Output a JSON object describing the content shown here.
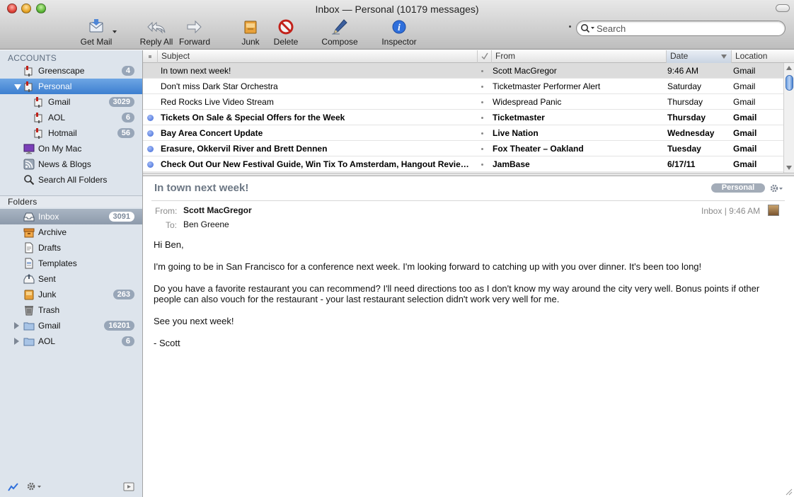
{
  "window": {
    "title": "Inbox — Personal (10179 messages)"
  },
  "toolbar": {
    "get_mail": "Get Mail",
    "reply_all": "Reply All",
    "forward": "Forward",
    "junk": "Junk",
    "delete": "Delete",
    "compose": "Compose",
    "inspector": "Inspector",
    "search_placeholder": "Search"
  },
  "sidebar": {
    "accounts_header": "ACCOUNTS",
    "folders_header": "Folders",
    "accounts": [
      {
        "label": "Greenscape",
        "badge": "4"
      },
      {
        "label": "Personal",
        "badge": ""
      },
      {
        "label": "Gmail",
        "badge": "3029"
      },
      {
        "label": "AOL",
        "badge": "6"
      },
      {
        "label": "Hotmail",
        "badge": "56"
      },
      {
        "label": "On My Mac",
        "badge": ""
      },
      {
        "label": "News & Blogs",
        "badge": ""
      },
      {
        "label": "Search All Folders",
        "badge": ""
      }
    ],
    "folders": [
      {
        "label": "Inbox",
        "badge": "3091"
      },
      {
        "label": "Archive",
        "badge": ""
      },
      {
        "label": "Drafts",
        "badge": ""
      },
      {
        "label": "Templates",
        "badge": ""
      },
      {
        "label": "Sent",
        "badge": ""
      },
      {
        "label": "Junk",
        "badge": "263"
      },
      {
        "label": "Trash",
        "badge": ""
      },
      {
        "label": "Gmail",
        "badge": "16201"
      },
      {
        "label": "AOL",
        "badge": "6"
      }
    ]
  },
  "message_list": {
    "columns": {
      "subject": "Subject",
      "from": "From",
      "date": "Date",
      "location": "Location"
    },
    "rows": [
      {
        "subject": "In town next week!",
        "from": "Scott MacGregor",
        "date": "9:46 AM",
        "location": "Gmail",
        "unread": false,
        "selected": true
      },
      {
        "subject": "Don't miss Dark Star Orchestra",
        "from": "Ticketmaster Performer Alert",
        "date": "Saturday",
        "location": "Gmail",
        "unread": false,
        "selected": false
      },
      {
        "subject": "Red Rocks Live Video Stream",
        "from": "Widespread Panic",
        "date": "Thursday",
        "location": "Gmail",
        "unread": false,
        "selected": false
      },
      {
        "subject": "Tickets On Sale & Special Offers for the Week",
        "from": "Ticketmaster",
        "date": "Thursday",
        "location": "Gmail",
        "unread": true,
        "selected": false
      },
      {
        "subject": "Bay Area Concert Update",
        "from": "Live Nation",
        "date": "Wednesday",
        "location": "Gmail",
        "unread": true,
        "selected": false
      },
      {
        "subject": "Erasure, Okkervil River and Brett Dennen",
        "from": "Fox Theater – Oakland",
        "date": "Tuesday",
        "location": "Gmail",
        "unread": true,
        "selected": false
      },
      {
        "subject": "Check Out Our New Festival Guide, Win Tix To Amsterdam, Hangout Review …",
        "from": "JamBase",
        "date": "6/17/11",
        "location": "Gmail",
        "unread": true,
        "selected": false
      }
    ]
  },
  "preview": {
    "subject": "In town next week!",
    "category": "Personal",
    "from_label": "From:",
    "from": "Scott MacGregor",
    "to_label": "To:",
    "to": "Ben Greene",
    "meta": "Inbox | 9:46 AM",
    "body": [
      "Hi Ben,",
      "I'm going to be in San Francisco for a conference next week. I'm looking forward to catching up with you over dinner. It's been too long!",
      "Do you have a favorite restaurant you can recommend? I'll need directions too as I don't know my way around the city very well. Bonus points if other people can also vouch for the restaurant - your last restaurant selection didn't work very well for me.",
      "See you next week!",
      "- Scott"
    ]
  },
  "colors": {
    "selection_blue": "#3d7fd0",
    "unread_dot": "#3a66d6",
    "sidebar_bg": "#dde4ec",
    "badge_bg": "#98a6b8"
  }
}
